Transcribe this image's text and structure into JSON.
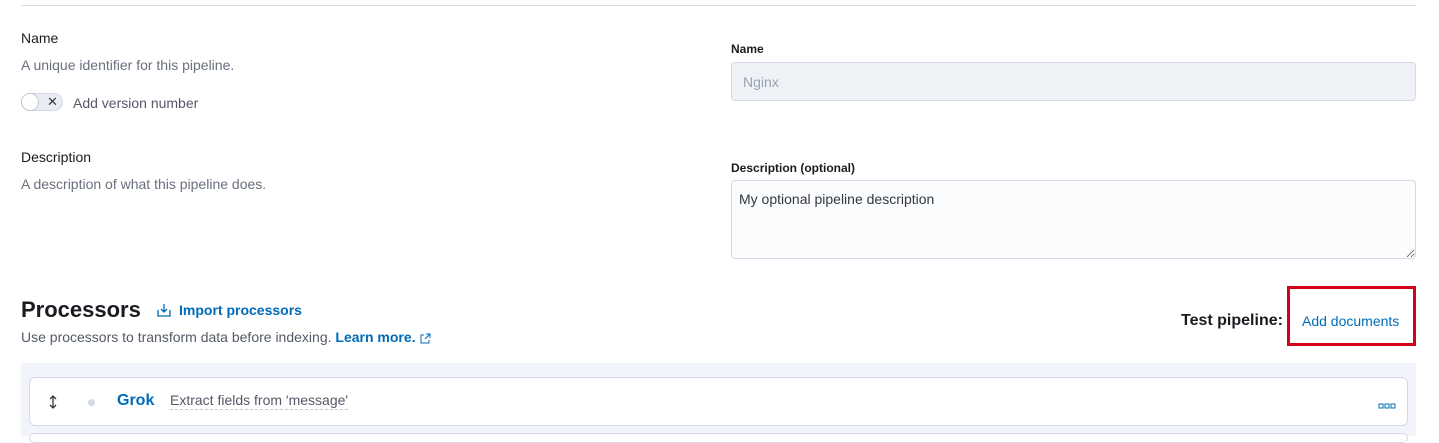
{
  "name_section": {
    "title": "Name",
    "description": "A unique identifier for this pipeline.",
    "toggle_label": "Add version number",
    "field_label": "Name",
    "field_value": "Nginx"
  },
  "description_section": {
    "title": "Description",
    "description": "A description of what this pipeline does.",
    "field_label": "Description (optional)",
    "field_value": "My optional pipeline description"
  },
  "processors": {
    "title": "Processors",
    "import_label": "Import processors",
    "subtitle": "Use processors to transform data before indexing.",
    "learn_more": "Learn more.",
    "test_pipeline_label": "Test pipeline:",
    "add_documents_label": "Add documents",
    "items": [
      {
        "name": "Grok",
        "description": "Extract fields from 'message'"
      }
    ]
  },
  "colors": {
    "accent": "#006bb8",
    "highlight": "#d6001c"
  },
  "icons": [
    "close-icon",
    "import-icon",
    "external-link-icon",
    "drag-handle-icon",
    "status-dot-icon",
    "more-actions-icon"
  ]
}
